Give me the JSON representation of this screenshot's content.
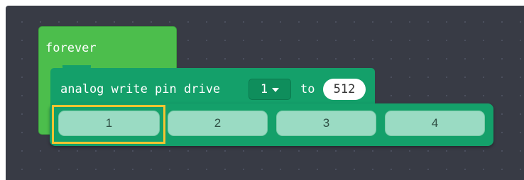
{
  "blocks": {
    "forever": {
      "label": "forever"
    },
    "analog_write": {
      "label": "analog write pin drive",
      "pin_value": "1",
      "to_label": "to",
      "value": "512"
    }
  },
  "pin_dropdown": {
    "options": [
      "1",
      "2",
      "3",
      "4"
    ],
    "highlighted_index": 0
  },
  "colors": {
    "workspace": "#383b45",
    "forever_block": "#4cbe4c",
    "analog_block": "#14a06a",
    "option_fill": "#9adbc3",
    "highlight": "#f6c431"
  }
}
